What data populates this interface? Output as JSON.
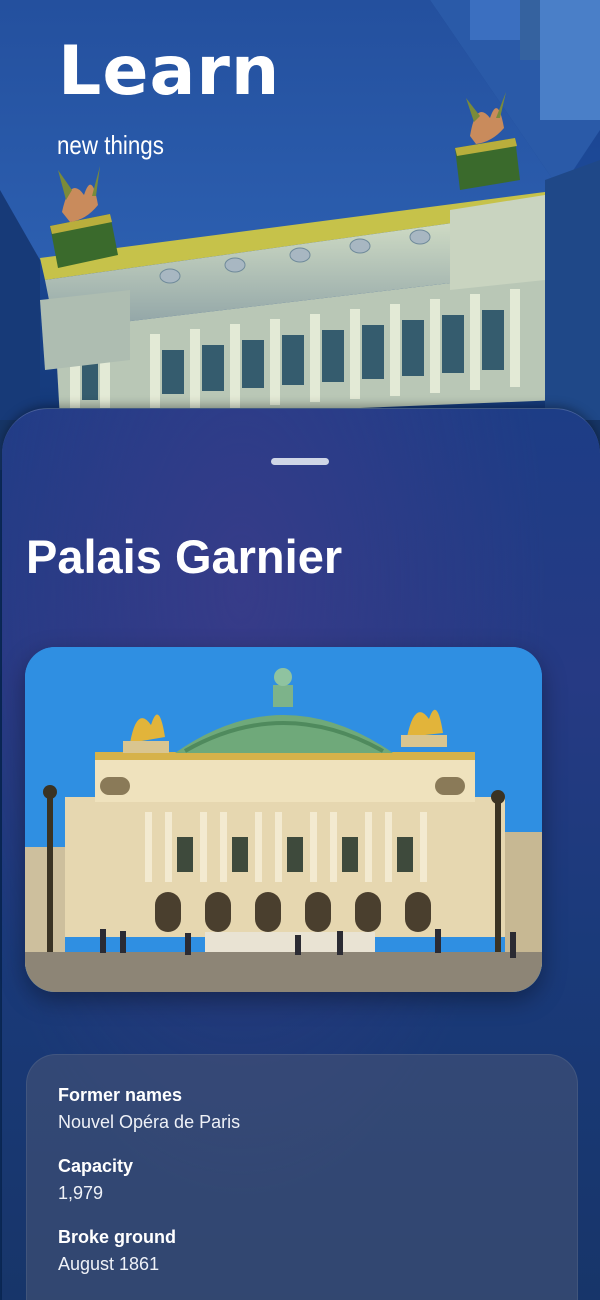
{
  "hero": {
    "title": "Learn",
    "subtitle": "new things"
  },
  "sheet": {
    "title": "Palais Garnier",
    "photo_alt": "Palais Garnier facade photo",
    "details": [
      {
        "label": "Former names",
        "value": "Nouvel Opéra de Paris"
      },
      {
        "label": "Capacity",
        "value": "1,979"
      },
      {
        "label": "Broke ground",
        "value": "August 1861"
      }
    ]
  },
  "colors": {
    "background": "#0c2e63",
    "sheet": "#263a84",
    "card": "#48567680",
    "grabber": "#cfd6e6"
  }
}
